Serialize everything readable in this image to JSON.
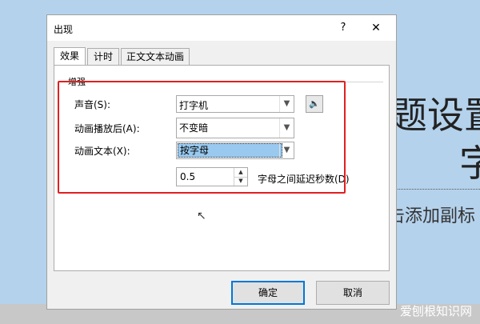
{
  "background": {
    "large_text_1": "题设置",
    "large_text_2": "字",
    "subtitle_text": "击添加副标",
    "watermark": "爱刨根知识网"
  },
  "dialog": {
    "title": "出现",
    "help_label": "?",
    "close_label": "✕",
    "tabs": [
      {
        "label": "效果",
        "active": true
      },
      {
        "label": "计时",
        "active": false
      },
      {
        "label": "正文文本动画",
        "active": false
      }
    ],
    "group_label": "增强",
    "sound": {
      "label": "声音(S):",
      "value": "打字机"
    },
    "after_animation": {
      "label": "动画播放后(A):",
      "value": "不变暗"
    },
    "animate_text": {
      "label": "动画文本(X):",
      "value": "按字母"
    },
    "delay": {
      "value": "0.5",
      "label": "字母之间延迟秒数(D)"
    },
    "ok_label": "确定",
    "cancel_label": "取消"
  },
  "colors": {
    "highlight_box": "#e02020",
    "selection": "#99c9ef",
    "default_button_border": "#0078d7"
  }
}
